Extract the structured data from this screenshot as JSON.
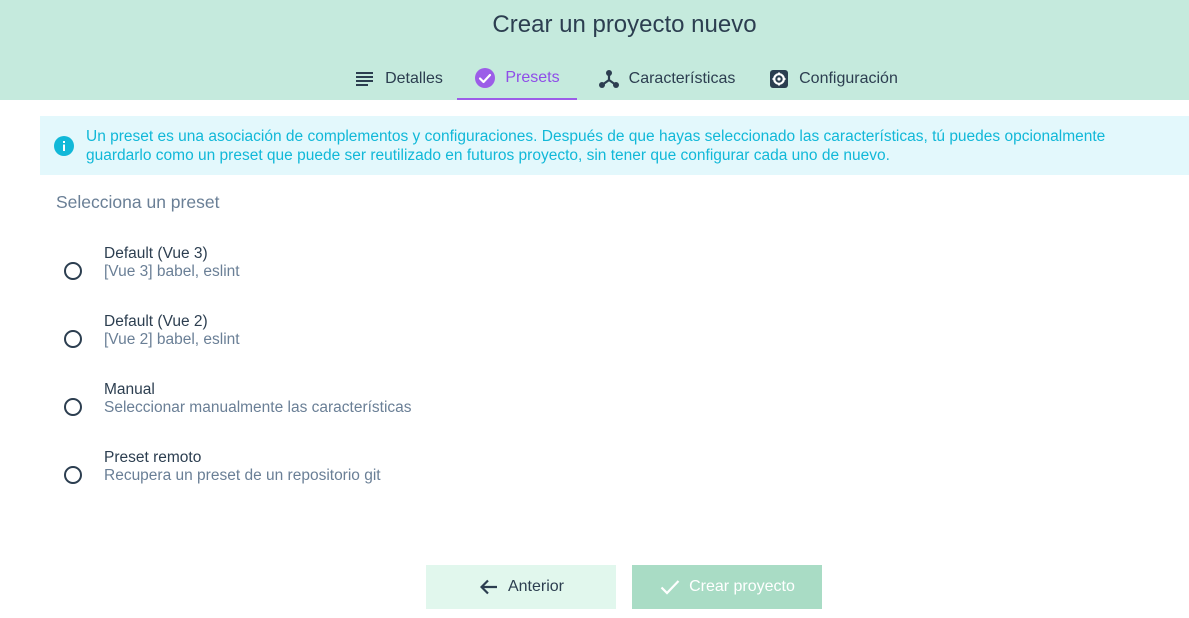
{
  "header": {
    "title": "Crear un proyecto nuevo",
    "tabs": [
      {
        "label": "Detalles",
        "icon": "list-icon",
        "active": false
      },
      {
        "label": "Presets",
        "icon": "check-circle-icon",
        "active": true
      },
      {
        "label": "Características",
        "icon": "hub-icon",
        "active": false
      },
      {
        "label": "Configuración",
        "icon": "gear-icon",
        "active": false
      }
    ]
  },
  "info": {
    "icon": "info-icon",
    "line1": "Un preset es una asociación de complementos y configuraciones. Después de que hayas seleccionado las características, tú puedes opcionalmente",
    "line2": "guardarlo como un preset que puede ser reutilizado en futuros proyecto, sin tener que configurar cada uno de nuevo."
  },
  "presets": {
    "title": "Selecciona un preset",
    "options": [
      {
        "name": "Default (Vue 3)",
        "description": "[Vue 3] babel, eslint"
      },
      {
        "name": "Default (Vue 2)",
        "description": "[Vue 2] babel, eslint"
      },
      {
        "name": "Manual",
        "description": "Seleccionar manualmente las características"
      },
      {
        "name": "Preset remoto",
        "description": "Recupera un preset de un repositorio git"
      }
    ]
  },
  "actions": {
    "previous_label": "Anterior",
    "create_label": "Crear proyecto"
  },
  "colors": {
    "header_bg": "#c5eadd",
    "accent_purple": "#8f4de8",
    "info_bg": "#e3f8fc",
    "info_text": "#11b8d8",
    "primary_text": "#2c3e50",
    "secondary_text": "#6a7f96"
  }
}
